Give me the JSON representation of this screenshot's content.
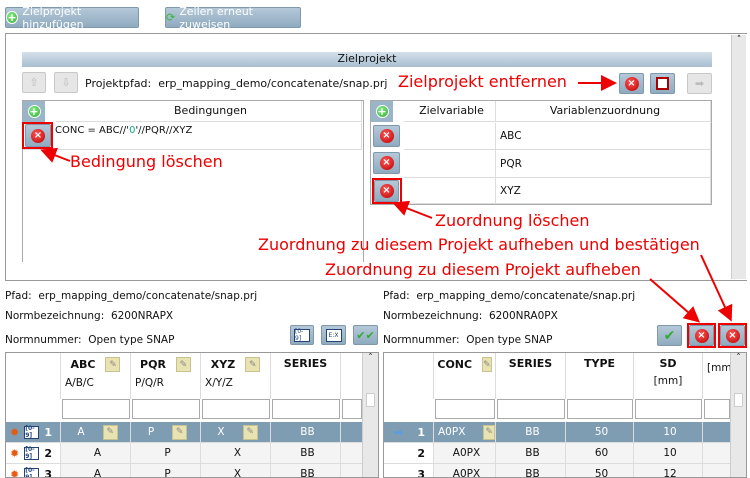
{
  "toolbar": {
    "add_target": "Zielprojekt hinzufügen",
    "reassign": "Zeilen erneut zuweisen"
  },
  "target": {
    "header": "Zielprojekt",
    "path_label": "Projektpfad:",
    "path": "erp_mapping_demo/concatenate/snap.prj",
    "conditions": {
      "header": "Bedingungen",
      "rows": [
        {
          "pre": "CONC = ABC//'",
          "green": "0",
          "post": "'//PQR//XYZ"
        }
      ]
    },
    "mapping": {
      "headers": [
        "Zielvariable",
        "Variablenzuordnung"
      ],
      "rows": [
        {
          "target": "",
          "source": "ABC"
        },
        {
          "target": "",
          "source": "PQR"
        },
        {
          "target": "",
          "source": "XYZ"
        }
      ]
    }
  },
  "annotations": {
    "remove_target": "Zielprojekt entfernen",
    "delete_condition": "Bedingung löschen",
    "delete_mapping": "Zuordnung löschen",
    "unassign_confirm": "Zuordnung zu diesem Projekt aufheben und bestätigen",
    "unassign": "Zuordnung zu diesem Projekt aufheben"
  },
  "left": {
    "path_label": "Pfad:",
    "path": "erp_mapping_demo/concatenate/snap.prj",
    "name_label": "Normbezeichnung:",
    "name": "6200NRAPX",
    "num_label": "Normnummer:",
    "num": "Open type SNAP",
    "columns": [
      {
        "title": "ABC",
        "sub": "A/B/C"
      },
      {
        "title": "PQR",
        "sub": "P/Q/R"
      },
      {
        "title": "XYZ",
        "sub": "X/Y/Z"
      },
      {
        "title": "SERIES",
        "sub": ""
      }
    ],
    "rows": [
      {
        "n": "1",
        "v": [
          "A",
          "P",
          "X",
          "BB"
        ]
      },
      {
        "n": "2",
        "v": [
          "A",
          "P",
          "X",
          "BB"
        ]
      },
      {
        "n": "3",
        "v": [
          "A",
          "P",
          "X",
          "BB"
        ]
      }
    ]
  },
  "right": {
    "path_label": "Pfad:",
    "path": "erp_mapping_demo/concatenate/snap.prj",
    "name_label": "Normbezeichnung:",
    "name": "6200NRA0PX",
    "num_label": "Normnummer:",
    "num": "Open type SNAP",
    "columns": [
      {
        "title": "CONC",
        "sub": ""
      },
      {
        "title": "SERIES",
        "sub": ""
      },
      {
        "title": "TYPE",
        "sub": ""
      },
      {
        "title": "SD",
        "sub": "[mm]"
      },
      {
        "title": "",
        "sub": "[mm"
      }
    ],
    "rows": [
      {
        "n": "1",
        "v": [
          "A0PX",
          "BB",
          "50",
          "10"
        ]
      },
      {
        "n": "2",
        "v": [
          "A0PX",
          "BB",
          "60",
          "10"
        ]
      },
      {
        "n": "3",
        "v": [
          "A0PX",
          "BB",
          "50",
          "12"
        ]
      }
    ]
  },
  "colors": {
    "accent": "#7e9db3",
    "annotation": "#ee0000"
  }
}
